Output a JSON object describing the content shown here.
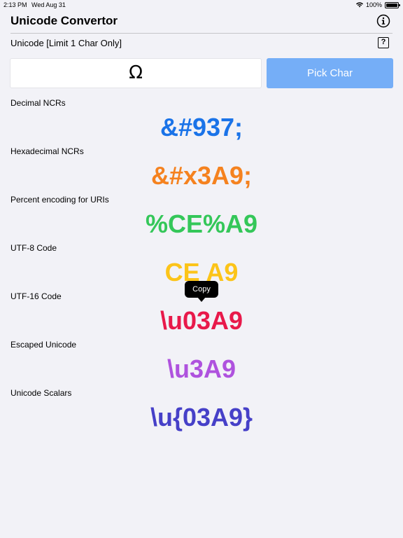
{
  "status_bar": {
    "time": "2:13 PM",
    "date": "Wed Aug 31",
    "battery": "100%",
    "wifi_icon": "wifi-icon",
    "battery_icon": "battery-icon"
  },
  "nav": {
    "title": "Unicode Convertor",
    "info_icon": "info-icon"
  },
  "input": {
    "label": "Unicode [Limit 1 Char Only]",
    "help_icon": "question-icon",
    "help_glyph": "?",
    "value": "Ω",
    "pick_label": "Pick Char"
  },
  "conversions": [
    {
      "label": "Decimal NCRs",
      "value": "&#937;",
      "color": "#1a73e8"
    },
    {
      "label": "Hexadecimal NCRs",
      "value": "&#x3A9;",
      "color": "#f5821f"
    },
    {
      "label": "Percent encoding for URIs",
      "value": "%CE%A9",
      "color": "#34c759"
    },
    {
      "label": "UTF-8 Code",
      "value": "CE A9",
      "color": "#fcc419"
    },
    {
      "label": "UTF-16 Code",
      "value": "\\u03A9",
      "color": "#e8194a"
    },
    {
      "label": "Escaped Unicode",
      "value": "\\u3A9",
      "color": "#af52de"
    },
    {
      "label": "Unicode Scalars",
      "value": "\\u{03A9}",
      "color": "#4640c8"
    }
  ],
  "tooltip": {
    "label": "Copy"
  }
}
